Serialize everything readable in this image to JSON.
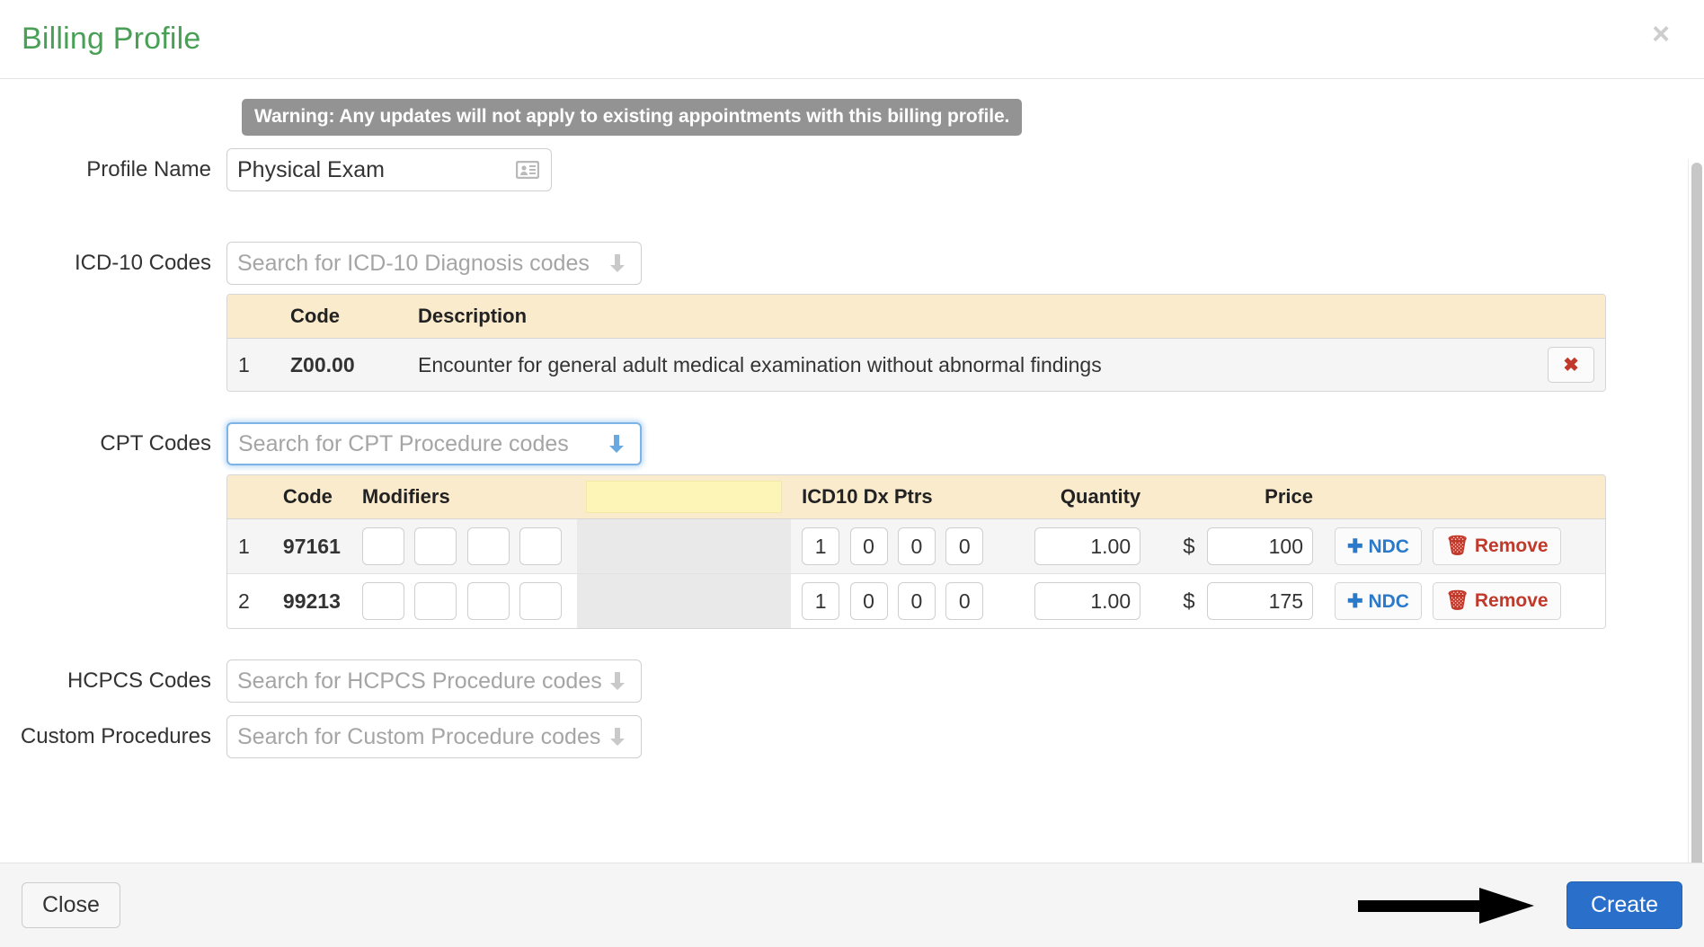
{
  "header": {
    "title": "Billing Profile",
    "close_icon": "close-icon",
    "close_glyph": "×"
  },
  "warning": {
    "text": "Warning: Any updates will not apply to existing appointments with this billing profile.",
    "background": "#939393",
    "color": "#ffffff"
  },
  "profile_name": {
    "label": "Profile Name",
    "value": "Physical Exam",
    "placeholder": "",
    "icon": "contact-card-icon"
  },
  "icd10": {
    "label": "ICD-10 Codes",
    "search_placeholder": "Search for ICD-10 Diagnosis codes",
    "dropdown_icon": "arrow-down-icon",
    "columns": [
      "",
      "Code",
      "Description",
      ""
    ],
    "rows": [
      {
        "index": "1",
        "code": "Z00.00",
        "description": "Encounter for general adult medical examination without abnormal findings",
        "remove_label": "✖"
      }
    ]
  },
  "cpt": {
    "label": "CPT Codes",
    "search_placeholder": "Search for CPT Procedure codes",
    "dropdown_icon": "arrow-down-icon",
    "focused": true,
    "columns": [
      "",
      "Code",
      "Modifiers",
      "",
      "ICD10 Dx Ptrs",
      "Quantity",
      "Price",
      ""
    ],
    "rows": [
      {
        "index": "1",
        "code": "97161",
        "modifiers": [
          "",
          "",
          "",
          ""
        ],
        "dx_ptrs": [
          "1",
          "0",
          "0",
          "0"
        ],
        "quantity": "1.00",
        "currency": "$",
        "price": "100",
        "ndc_label": "NDC",
        "ndc_icon": "plus-icon",
        "remove_label": "Remove",
        "remove_icon": "trash-icon"
      },
      {
        "index": "2",
        "code": "99213",
        "modifiers": [
          "",
          "",
          "",
          ""
        ],
        "dx_ptrs": [
          "1",
          "0",
          "0",
          "0"
        ],
        "quantity": "1.00",
        "currency": "$",
        "price": "175",
        "ndc_label": "NDC",
        "ndc_icon": "plus-icon",
        "remove_label": "Remove",
        "remove_icon": "trash-icon"
      }
    ]
  },
  "hcpcs": {
    "label": "HCPCS Codes",
    "search_placeholder": "Search for HCPCS Procedure codes",
    "dropdown_icon": "arrow-down-icon"
  },
  "custom_procedures": {
    "label": "Custom Procedures",
    "search_placeholder": "Search for Custom Procedure codes",
    "dropdown_icon": "arrow-down-icon"
  },
  "footer": {
    "close_label": "Close",
    "create_label": "Create",
    "annotation_icon": "black-arrow-pointing-right"
  },
  "colors": {
    "title_green": "#4a9f56",
    "primary_blue": "#2a6fc9",
    "table_header_tan": "#faebcd",
    "highlight_yellow": "#fdf5b8",
    "danger_red": "#c0392b",
    "link_blue": "#2a7ac9",
    "warning_gray": "#939393"
  }
}
